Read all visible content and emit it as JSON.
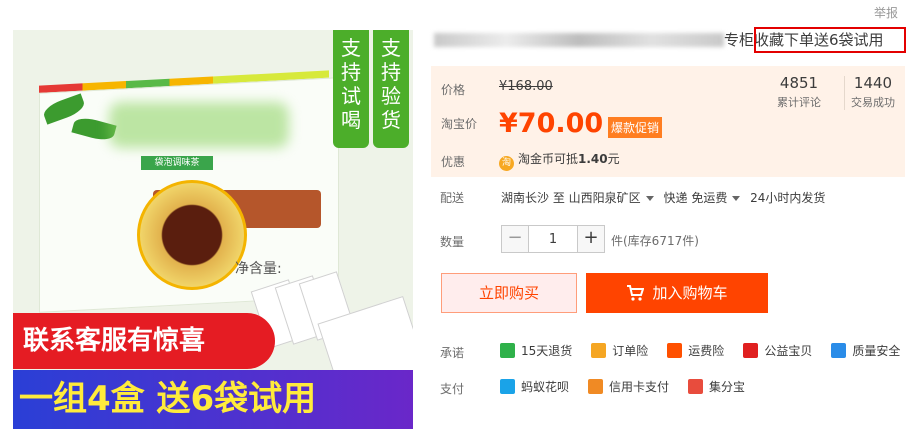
{
  "report": "举报",
  "product_image": {
    "badge_1": [
      "支",
      "持",
      "试",
      "喝"
    ],
    "badge_2": [
      "支",
      "持",
      "验",
      "货"
    ],
    "tag_text": "袋泡调味茶",
    "net_content": "净含量:",
    "banner_red": "联系客服有惊喜",
    "banner_blue": "一组4盒 送6袋试用"
  },
  "title": {
    "visible_tail": "专柜",
    "highlight": "收藏下单送6袋试用"
  },
  "price": {
    "label": "价格",
    "original": "¥168.00",
    "tb_label": "淘宝价",
    "current": "¥70.00",
    "promo_tag": "爆款促销"
  },
  "stats": {
    "reviews_count": "4851",
    "reviews_label": "累计评论",
    "deals_count": "1440",
    "deals_label": "交易成功"
  },
  "discount": {
    "label": "优惠",
    "coin_icon": "淘",
    "text_prefix": "淘金币可抵",
    "amount": "1.40",
    "unit": "元"
  },
  "delivery": {
    "label": "配送",
    "origin": "湖南长沙 至",
    "destination": "山西阳泉矿区",
    "shipping": "快递 免运费",
    "dispatch": "24小时内发货"
  },
  "quantity": {
    "label": "数量",
    "minus": "−",
    "plus": "+",
    "value": "1",
    "stock": "件(库存6717件)"
  },
  "buttons": {
    "buy_now": "立即购买",
    "add_to_cart": "加入购物车"
  },
  "promises": {
    "label": "承诺",
    "items": [
      {
        "text": "15天退货",
        "icon": "return-icon",
        "color": "#2fb14a"
      },
      {
        "text": "订单险",
        "icon": "order-insurance-icon",
        "color": "#f5a623"
      },
      {
        "text": "运费险",
        "icon": "shipping-insurance-icon",
        "color": "#ff5000"
      },
      {
        "text": "公益宝贝",
        "icon": "charity-icon",
        "color": "#e02020"
      },
      {
        "text": "质量安全",
        "icon": "quality-icon",
        "color": "#2a8ce8"
      }
    ]
  },
  "payments": {
    "label": "支付",
    "items": [
      {
        "text": "蚂蚁花呗",
        "icon": "huabei-icon",
        "color": "#1aa3e8"
      },
      {
        "text": "信用卡支付",
        "icon": "credit-card-icon",
        "color": "#f08a24"
      },
      {
        "text": "集分宝",
        "icon": "jifenbao-icon",
        "color": "#e84c3d"
      }
    ]
  }
}
